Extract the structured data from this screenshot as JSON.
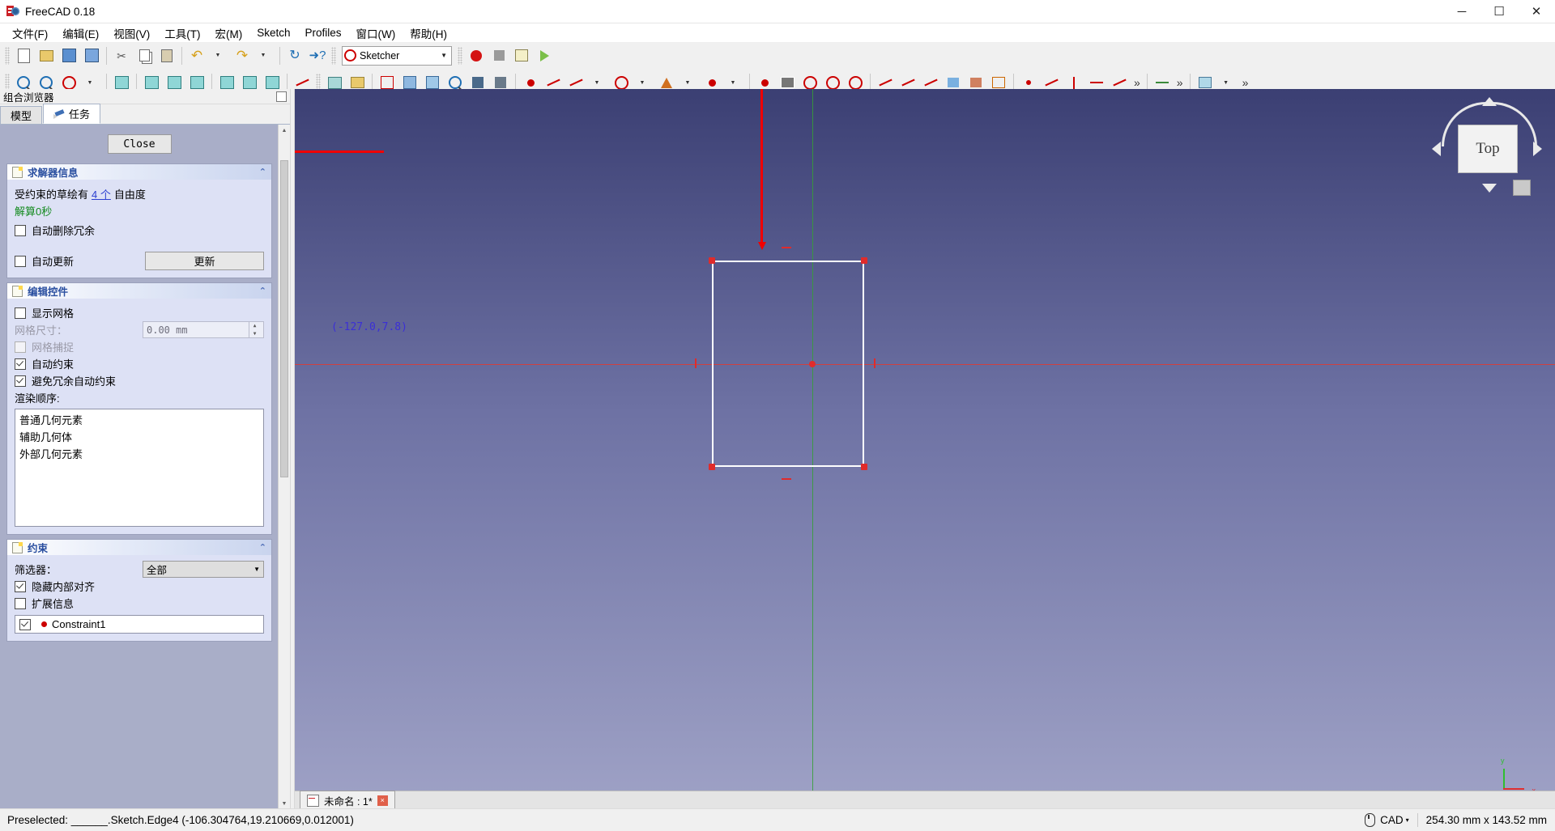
{
  "window": {
    "title": "FreeCAD 0.18",
    "icon": "freecad-logo-icon",
    "minimize": "─",
    "maximize": "☐",
    "close": "✕"
  },
  "menubar": {
    "items": [
      {
        "label": "文件(F)",
        "name": "menu-file"
      },
      {
        "label": "编辑(E)",
        "name": "menu-edit"
      },
      {
        "label": "视图(V)",
        "name": "menu-view"
      },
      {
        "label": "工具(T)",
        "name": "menu-tools"
      },
      {
        "label": "宏(M)",
        "name": "menu-macro"
      },
      {
        "label": "Sketch",
        "name": "menu-sketch"
      },
      {
        "label": "Profiles",
        "name": "menu-profiles"
      },
      {
        "label": "窗口(W)",
        "name": "menu-window"
      },
      {
        "label": "帮助(H)",
        "name": "menu-help"
      }
    ]
  },
  "toolbar": {
    "workbench_selector": {
      "value": "Sketcher",
      "icon": "sketcher-icon",
      "arrow": "▼"
    },
    "overflow": "»"
  },
  "dock": {
    "title": "组合浏览器",
    "tabs": [
      {
        "label": "模型",
        "name": "tab-model",
        "active": false
      },
      {
        "label": "任务",
        "name": "tab-tasks",
        "active": true,
        "icon": "pencil-icon"
      }
    ],
    "close_button": "Close",
    "solver": {
      "heading": "求解器信息",
      "dof_prefix": "受约束的草绘有",
      "dof_count": "4 个",
      "dof_suffix": "自由度",
      "solve_time": "解算0秒",
      "auto_remove_redundant": "自动删除冗余",
      "auto_remove_redundant_checked": false,
      "auto_update": "自动更新",
      "auto_update_checked": false,
      "update_button": "更新",
      "collapse": "⌃"
    },
    "edit_controls": {
      "heading": "编辑控件",
      "show_grid": "显示网格",
      "show_grid_checked": false,
      "grid_size_label": "网格尺寸：",
      "grid_size_value": "0.00 mm",
      "grid_snap": "网格捕捉",
      "grid_snap_checked": false,
      "auto_constraint": "自动约束",
      "auto_constraint_checked": true,
      "avoid_redundant": "避免冗余自动约束",
      "avoid_redundant_checked": true,
      "render_order_label": "渲染顺序:",
      "render_order": [
        "普通几何元素",
        "辅助几何体",
        "外部几何元素"
      ],
      "collapse": "⌃"
    },
    "constraints": {
      "heading": "约束",
      "filter_label": "筛选器：",
      "filter_value": "全部",
      "filter_arrow": "▼",
      "hide_internal": "隐藏内部对齐",
      "hide_internal_checked": true,
      "extended_info": "扩展信息",
      "extended_info_checked": false,
      "items": [
        {
          "label": "Constraint1",
          "checked": true
        }
      ],
      "collapse": "⌃"
    }
  },
  "view3d": {
    "coordinate_readout": "(-127.0,7.8)",
    "nav_cube": {
      "face_label": "Top",
      "name": "navigation-cube"
    },
    "axis_labels": {
      "x": "x",
      "y": "y"
    },
    "document_tab": {
      "label": "未命名 : 1*",
      "close": "×"
    }
  },
  "statusbar": {
    "preselected": "Preselected: ______.Sketch.Edge4 (-106.304764,19.210669,0.012001)",
    "nav_style": "CAD",
    "nav_arrow": "▾",
    "dimensions": "254.30 mm x 143.52 mm"
  },
  "colors": {
    "accent_blue": "#2a4fa0",
    "panel_bg": "#dde1f5",
    "annotation_red": "#f00000",
    "sketch_white": "#ffffff",
    "vertex_red": "#e02b2b",
    "axis_green": "#35a035",
    "axis_red": "#d04040",
    "coord_text": "#3b2fd6",
    "solve_green": "#138a1f"
  }
}
